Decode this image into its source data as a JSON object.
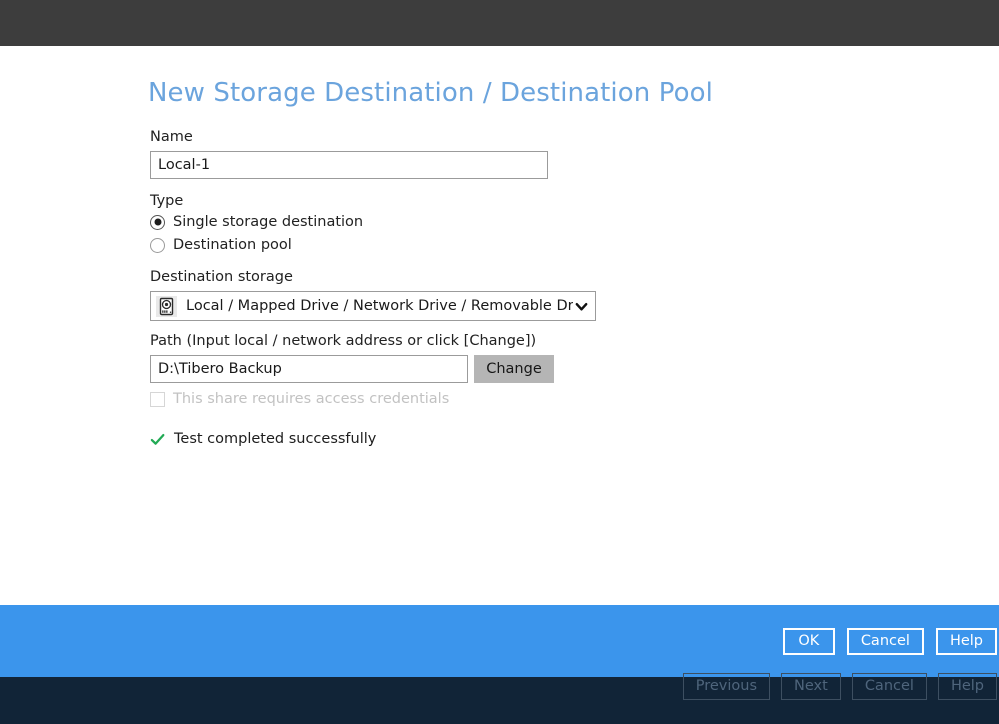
{
  "window": {
    "top_bar_color": "#3d3d3d",
    "content_background": "#ffffff"
  },
  "dialog": {
    "title": "New Storage Destination / Destination Pool",
    "title_color": "#6ba4dd",
    "fields": {
      "name": {
        "label": "Name",
        "value": "Local-1",
        "placeholder": ""
      },
      "type": {
        "label": "Type",
        "options": [
          {
            "label": "Single storage destination",
            "selected": true
          },
          {
            "label": "Destination pool",
            "selected": false
          }
        ]
      },
      "destination_storage": {
        "label": "Destination storage",
        "selected": "Local / Mapped Drive / Network Drive / Removable Drive",
        "icon": "hard-drive-icon",
        "chevron": "chevron-down-icon"
      },
      "path": {
        "label": "Path (Input local / network address or click [Change])",
        "value": "D:\\Tibero Backup",
        "placeholder": "",
        "change_button": "Change"
      },
      "credentials": {
        "label": "This share requires access credentials",
        "checked": false,
        "disabled": true
      }
    },
    "status": {
      "icon": "check-mark-icon",
      "text": "Test completed successfully",
      "color": "#22aa55"
    }
  },
  "footer": {
    "background": "#3b95ec",
    "buttons": [
      {
        "label": "OK"
      },
      {
        "label": "Cancel"
      },
      {
        "label": "Help"
      }
    ]
  },
  "wizard_bar": {
    "background": "#112437",
    "buttons": [
      {
        "label": "Previous",
        "disabled": true
      },
      {
        "label": "Next",
        "disabled": true
      },
      {
        "label": "Cancel",
        "disabled": true
      },
      {
        "label": "Help",
        "disabled": true
      }
    ]
  }
}
